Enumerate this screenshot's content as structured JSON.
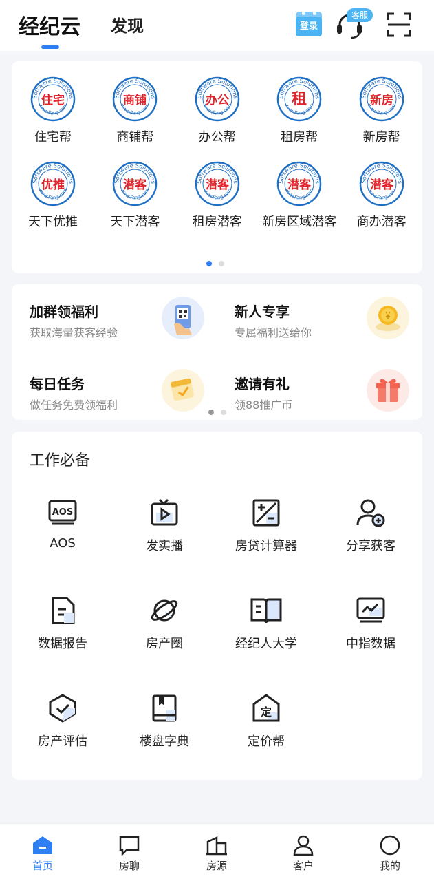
{
  "header": {
    "tabs": [
      "经纪云",
      "发现"
    ],
    "login_label": "登录",
    "service_label": "客服"
  },
  "shortcuts": [
    {
      "label": "住宅帮",
      "logo_text": "住宅",
      "icon": "zhuzhai-logo-icon"
    },
    {
      "label": "商铺帮",
      "logo_text": "商铺",
      "icon": "shangpu-logo-icon"
    },
    {
      "label": "办公帮",
      "logo_text": "办公",
      "icon": "bangong-logo-icon"
    },
    {
      "label": "租房帮",
      "logo_text": "租",
      "icon": "zufang-logo-icon"
    },
    {
      "label": "新房帮",
      "logo_text": "新房",
      "icon": "xinfang-logo-icon"
    },
    {
      "label": "天下优推",
      "logo_text": "优推",
      "icon": "youtui-logo-icon"
    },
    {
      "label": "天下潜客",
      "logo_text": "潜客",
      "icon": "qianke-logo-icon"
    },
    {
      "label": "租房潜客",
      "logo_text": "潜客",
      "icon": "zufang-qianke-logo-icon"
    },
    {
      "label": "新房区域潜客",
      "logo_text": "潜客",
      "icon": "xinfang-qianke-logo-icon"
    },
    {
      "label": "商办潜客",
      "logo_text": "潜客",
      "icon": "shangban-qianke-logo-icon"
    }
  ],
  "logo_ring_text": "Software Solutions",
  "logo_bottom_text": "www.Fang.com",
  "promos": [
    {
      "title": "加群领福利",
      "subtitle": "获取海量获客经验",
      "icon": "qr-phone-icon"
    },
    {
      "title": "新人专享",
      "subtitle": "专属福利送给你",
      "icon": "coin-icon"
    },
    {
      "title": "每日任务",
      "subtitle": "做任务免费领福利",
      "icon": "calendar-check-icon"
    },
    {
      "title": "邀请有礼",
      "subtitle": "领88推广币",
      "icon": "gift-icon"
    }
  ],
  "tools_section": {
    "title": "工作必备",
    "items": [
      {
        "label": "AOS",
        "icon": "aos-monitor-icon"
      },
      {
        "label": "发实播",
        "icon": "tv-play-icon"
      },
      {
        "label": "房贷计算器",
        "icon": "calculator-icon"
      },
      {
        "label": "分享获客",
        "icon": "add-user-icon"
      },
      {
        "label": "数据报告",
        "icon": "document-icon"
      },
      {
        "label": "房产圈",
        "icon": "planet-icon"
      },
      {
        "label": "经纪人大学",
        "icon": "open-book-icon"
      },
      {
        "label": "中指数据",
        "icon": "chart-monitor-icon"
      },
      {
        "label": "房产评估",
        "icon": "shield-check-icon"
      },
      {
        "label": "楼盘字典",
        "icon": "bookmark-book-icon"
      },
      {
        "label": "定价帮",
        "icon": "house-ding-icon"
      }
    ],
    "aos_text": "AOS",
    "ding_text": "定"
  },
  "bottom_nav": [
    {
      "label": "首页",
      "icon": "home-icon",
      "active": true
    },
    {
      "label": "房聊",
      "icon": "chat-icon",
      "active": false
    },
    {
      "label": "房源",
      "icon": "building-icon",
      "active": false
    },
    {
      "label": "客户",
      "icon": "person-icon",
      "active": false
    },
    {
      "label": "我的",
      "icon": "profile-circle-icon",
      "active": false
    }
  ],
  "colors": {
    "accent": "#2d7ff3",
    "logo_red": "#e0242b",
    "logo_blue": "#1f6fc5"
  }
}
